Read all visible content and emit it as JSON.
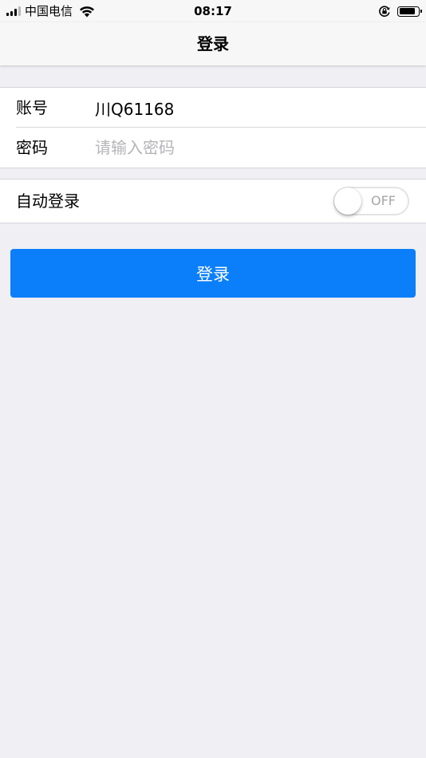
{
  "status_bar": {
    "carrier": "中国电信",
    "time": "08:17",
    "battery_level": 0.9,
    "signal_bars": 4,
    "signal_bars_active": 3
  },
  "nav": {
    "title": "登录"
  },
  "login_form": {
    "account_label": "账号",
    "account_value": "川Q61168",
    "password_label": "密码",
    "password_placeholder": "请输入密码",
    "password_value": ""
  },
  "auto_login": {
    "label": "自动登录",
    "toggle_text": "OFF",
    "enabled": false
  },
  "login_button": {
    "label": "登录"
  },
  "colors": {
    "accent": "#0a7ff9",
    "background": "#efeff4",
    "nav_background": "#f7f7f7",
    "placeholder": "#b4b4b8"
  },
  "icons": {
    "signal": "cellular-signal-icon",
    "wifi": "wifi-icon",
    "rotation_lock": "rotation-lock-icon",
    "battery": "battery-icon"
  }
}
